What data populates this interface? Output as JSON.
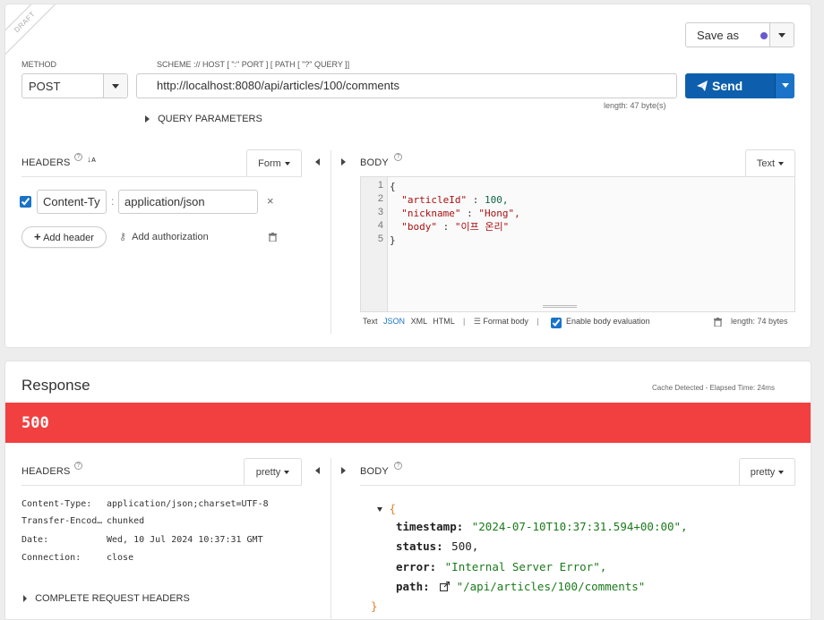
{
  "request": {
    "draft_label": "DRAFT",
    "save_as_label": "Save as",
    "save_dot_color": "#6a5acd",
    "method_label": "METHOD",
    "method_value": "POST",
    "url_hint": "SCHEME :// HOST [ \":\" PORT ] [ PATH [ \"?\" QUERY ]]",
    "url_value": "http://localhost:8080/api/articles/100/comments",
    "url_length": "length: 47 byte(s)",
    "send_label": "Send",
    "send_color": "#0d5fad",
    "query_params_label": "QUERY PARAMETERS",
    "headers_title": "HEADERS",
    "headers_mode": "Form",
    "header_row": {
      "checked": true,
      "name": "Content-Ty",
      "value": "application/json"
    },
    "add_header_label": "Add header",
    "add_auth_label": "Add authorization",
    "body_title": "BODY",
    "body_mode": "Text",
    "body_lines": [
      "1",
      "2",
      "3",
      "4",
      "5"
    ],
    "body_code": {
      "open": "{",
      "line2_key": "\"articleId\"",
      "line2_val": "100,",
      "line3_key": "\"nickname\"",
      "line3_val": "\"Hong\",",
      "line4_key": "\"body\"",
      "line4_val": "\"이프 온리\"",
      "close": "}"
    },
    "body_footer": {
      "text": "Text",
      "json": "JSON",
      "xml": "XML",
      "html": "HTML",
      "sep": "|",
      "format_body": "Format body",
      "enable_eval": "Enable body evaluation",
      "length": "length: 74 bytes"
    }
  },
  "response": {
    "title": "Response",
    "cache_info": "Cache Detected - Elapsed Time: 24ms",
    "status_code": "500",
    "status_color": "#f24040",
    "headers_title": "HEADERS",
    "headers_mode": "pretty",
    "body_title": "BODY",
    "body_mode": "pretty",
    "headers": [
      {
        "k": "Content-Type:",
        "v": "application/json;charset=UTF-8"
      },
      {
        "k": "Transfer-Encod…",
        "v": "chunked"
      },
      {
        "k": "Date:",
        "v": "Wed, 10 Jul 2024 10:37:31 GMT"
      },
      {
        "k": "Connection:",
        "v": "close"
      }
    ],
    "complete_headers_label": "COMPLETE REQUEST HEADERS",
    "json": {
      "open": "{",
      "timestamp_key": "timestamp:",
      "timestamp_val": "\"2024-07-10T10:37:31.594+00:00\",",
      "status_key": "status:",
      "status_val": "500,",
      "error_key": "error:",
      "error_val": "\"Internal Server Error\",",
      "path_key": "path:",
      "path_val": "\"/api/articles/100/comments\"",
      "close": "}"
    }
  }
}
